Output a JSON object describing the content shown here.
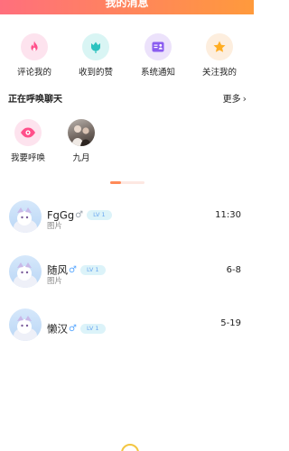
{
  "header": {
    "title": "我的消息"
  },
  "quick_actions": [
    {
      "label": "评论我的",
      "icon": "flame-icon"
    },
    {
      "label": "收到的赞",
      "icon": "tulip-icon"
    },
    {
      "label": "系统通知",
      "icon": "contact-card-icon"
    },
    {
      "label": "关注我的",
      "icon": "star-icon"
    }
  ],
  "calling": {
    "title": "正在呼唤聊天",
    "more_label": "更多",
    "items": [
      {
        "label": "我要呼唤",
        "icon": "eye-icon"
      },
      {
        "label": "九月",
        "icon": "avatar-photo"
      }
    ]
  },
  "chats": [
    {
      "name": "FgGg",
      "gender": "♂",
      "level": "LV 1",
      "preview": "图片",
      "time": "11:30"
    },
    {
      "name": "随风",
      "gender": "♂",
      "level": "LV 1",
      "preview": "图片",
      "time": "6-8"
    },
    {
      "name": "懒汉",
      "gender": "♂",
      "level": "LV 1",
      "preview": "",
      "time": "5-19"
    }
  ],
  "colors": {
    "accent_start": "#ff6f7d",
    "accent_end": "#ff9a3c",
    "gender_male": "#5aa8ff",
    "level_badge_bg": "#dcf3f9",
    "level_badge_text": "#6aa6f0"
  }
}
